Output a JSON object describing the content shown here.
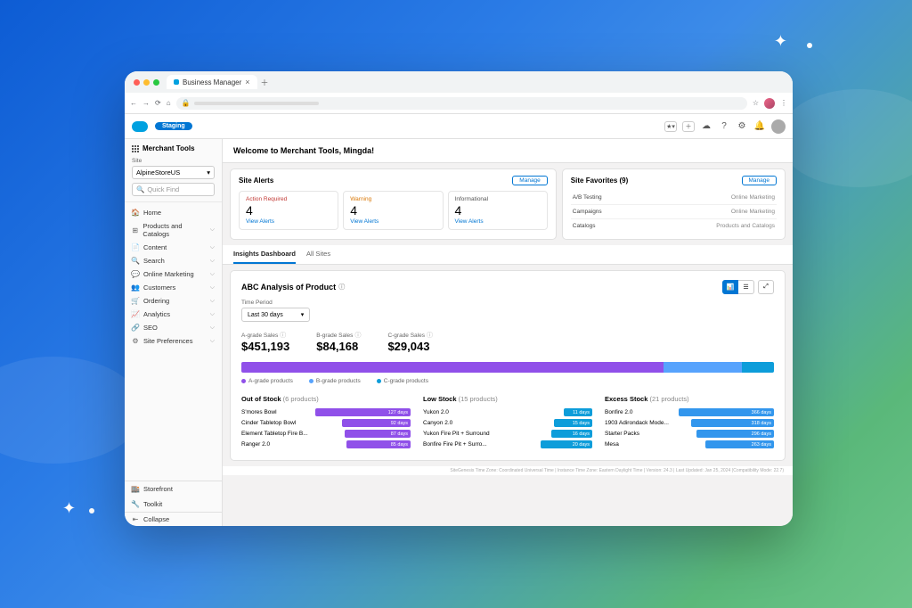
{
  "browser": {
    "tab_title": "Business Manager"
  },
  "header": {
    "staging_badge": "Staging"
  },
  "sidebar": {
    "title": "Merchant Tools",
    "site_label": "Site",
    "site_value": "AlpineStoreUS",
    "search_placeholder": "Quick Find",
    "items": [
      {
        "icon": "🏠",
        "label": "Home",
        "expandable": false
      },
      {
        "icon": "⊞",
        "label": "Products and Catalogs",
        "expandable": true
      },
      {
        "icon": "📄",
        "label": "Content",
        "expandable": true
      },
      {
        "icon": "🔍",
        "label": "Search",
        "expandable": true
      },
      {
        "icon": "💬",
        "label": "Online Marketing",
        "expandable": true
      },
      {
        "icon": "👥",
        "label": "Customers",
        "expandable": true
      },
      {
        "icon": "🛒",
        "label": "Ordering",
        "expandable": true
      },
      {
        "icon": "📈",
        "label": "Analytics",
        "expandable": true
      },
      {
        "icon": "🔗",
        "label": "SEO",
        "expandable": true
      },
      {
        "icon": "⚙",
        "label": "Site Preferences",
        "expandable": true
      }
    ],
    "bottom": [
      {
        "icon": "🏬",
        "label": "Storefront"
      },
      {
        "icon": "🔧",
        "label": "Toolkit"
      }
    ],
    "collapse": "Collapse"
  },
  "welcome": "Welcome to Merchant Tools, Mingda!",
  "alerts": {
    "title": "Site Alerts",
    "manage": "Manage",
    "boxes": [
      {
        "label": "Action Required",
        "count": "4",
        "link": "View Alerts",
        "cls": "req"
      },
      {
        "label": "Warning",
        "count": "4",
        "link": "View Alerts",
        "cls": "warn"
      },
      {
        "label": "Informational",
        "count": "4",
        "link": "View Alerts",
        "cls": "info"
      }
    ]
  },
  "favorites": {
    "title": "Site Favorites (9)",
    "manage": "Manage",
    "rows": [
      {
        "name": "A/B Testing",
        "cat": "Online Marketing"
      },
      {
        "name": "Campaigns",
        "cat": "Online Marketing"
      },
      {
        "name": "Catalogs",
        "cat": "Products and Catalogs"
      }
    ]
  },
  "tabs": {
    "items": [
      "Insights Dashboard",
      "All Sites"
    ],
    "active": 0
  },
  "chart_data": {
    "title": "ABC Analysis of Product",
    "time_period_label": "Time Period",
    "time_period_value": "Last 30 days",
    "grades": [
      {
        "label": "A-grade Sales",
        "value": "$451,193",
        "raw": 451193
      },
      {
        "label": "B-grade Sales",
        "value": "$84,168",
        "raw": 84168
      },
      {
        "label": "C-grade Sales",
        "value": "$29,043",
        "raw": 29043
      }
    ],
    "legend": [
      {
        "label": "A-grade products",
        "color": "#9050e9"
      },
      {
        "label": "B-grade products",
        "color": "#57a3fd"
      },
      {
        "label": "C-grade products",
        "color": "#0d9dda"
      }
    ],
    "stock_sections": [
      {
        "title": "Out of Stock",
        "count": "(6 products)",
        "color": "sb-purple",
        "items": [
          {
            "name": "S'mores Bowl",
            "days": "127 days",
            "pct": 100
          },
          {
            "name": "Cinder Tabletop Bowl",
            "days": "92 days",
            "pct": 72
          },
          {
            "name": "Element Tabletop Fire B...",
            "days": "87 days",
            "pct": 69
          },
          {
            "name": "Ranger 2.0",
            "days": "85 days",
            "pct": 67
          }
        ]
      },
      {
        "title": "Low Stock",
        "count": "(15 products)",
        "color": "sb-blue",
        "items": [
          {
            "name": "Yukon 2.0",
            "days": "11 days",
            "pct": 30
          },
          {
            "name": "Canyon 2.0",
            "days": "15 days",
            "pct": 40
          },
          {
            "name": "Yukon Fire Pit + Surround",
            "days": "16 days",
            "pct": 43
          },
          {
            "name": "Bonfire Fire Pit + Surro...",
            "days": "20 days",
            "pct": 54
          }
        ]
      },
      {
        "title": "Excess Stock",
        "count": "(21 products)",
        "color": "sb-blue2",
        "items": [
          {
            "name": "Bonfire 2.0",
            "days": "366 days",
            "pct": 100
          },
          {
            "name": "1903 Adirondack Mode...",
            "days": "318 days",
            "pct": 87
          },
          {
            "name": "Starter Packs",
            "days": "296 days",
            "pct": 81
          },
          {
            "name": "Mesa",
            "days": "263 days",
            "pct": 72
          }
        ]
      }
    ]
  },
  "footer": "SiteGenesis Time Zone: Coordinated Universal Time | Instance Time Zone: Eastern Daylight Time | Version: 24.3 | Last Updated: Jan 25, 2024 (Compatibility Mode: 22.7)"
}
